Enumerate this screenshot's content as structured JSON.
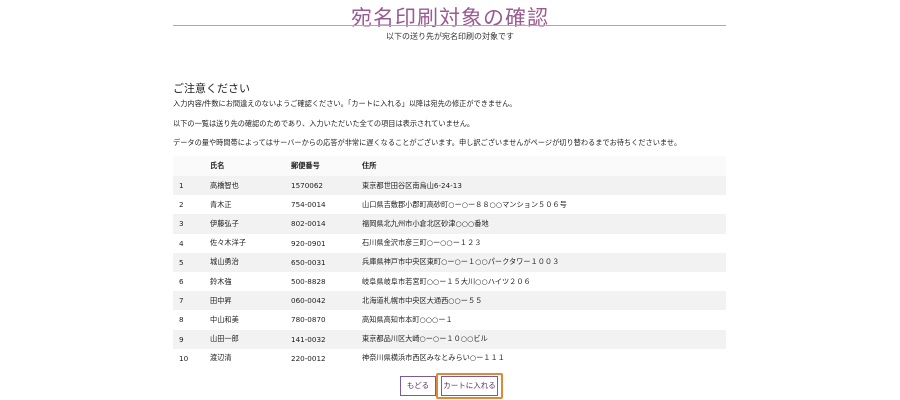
{
  "page": {
    "title": "宛名印刷対象の確認",
    "subtitle": "以下の送り先が宛名印刷の対象です"
  },
  "notice": {
    "heading": "ご注意ください",
    "lines": [
      "入力内容/件数にお間違えのないようご確認ください。「カートに入れる」以降は宛先の修正ができません。",
      "以下の一覧は送り先の確認のためであり、入力いただいた全ての項目は表示されていません。",
      "データの量や時間帯によってはサーバーからの応答が非常に遅くなることがございます。申し訳ございませんがページが切り替わるまでお待ちくださいませ。"
    ]
  },
  "table": {
    "headers": {
      "no": "",
      "name": "氏名",
      "zip": "郵便番号",
      "address": "住所"
    },
    "rows": [
      {
        "no": "1",
        "name": "高橋智也",
        "zip": "1570062",
        "address": "東京都世田谷区南烏山6-24-13"
      },
      {
        "no": "2",
        "name": "青木正",
        "zip": "754-0014",
        "address": "山口県吉敷郡小郡町高砂町○ー○ー８８○○マンション５０６号"
      },
      {
        "no": "3",
        "name": "伊藤弘子",
        "zip": "802-0014",
        "address": "福岡県北九州市小倉北区砂津○○○番地"
      },
      {
        "no": "4",
        "name": "佐々木洋子",
        "zip": "920-0901",
        "address": "石川県金沢市彦三町○ー○○ー１２３"
      },
      {
        "no": "5",
        "name": "城山勇治",
        "zip": "650-0031",
        "address": "兵庫県神戸市中央区東町○ー○ー１○○パークタワー１００３"
      },
      {
        "no": "6",
        "name": "鈴木強",
        "zip": "500-8828",
        "address": "岐阜県岐阜市若宮町○○ー１５大川○○ハイツ２０６"
      },
      {
        "no": "7",
        "name": "田中昇",
        "zip": "060-0042",
        "address": "北海道札幌市中央区大通西○○ー５５"
      },
      {
        "no": "8",
        "name": "中山和美",
        "zip": "780-0870",
        "address": "高知県高知市本町○○○ー１"
      },
      {
        "no": "9",
        "name": "山田一郎",
        "zip": "141-0032",
        "address": "東京都品川区大崎○ー○ー１０○○ビル"
      },
      {
        "no": "10",
        "name": "渡辺清",
        "zip": "220-0012",
        "address": "神奈川県横浜市西区みなとみらい○ー１１１"
      }
    ]
  },
  "buttons": {
    "back": "もどる",
    "cart": "カートに入れる"
  },
  "colors": {
    "title": "#9a5a92",
    "button_text": "#5b2d66",
    "highlight_border": "#e0873a"
  }
}
